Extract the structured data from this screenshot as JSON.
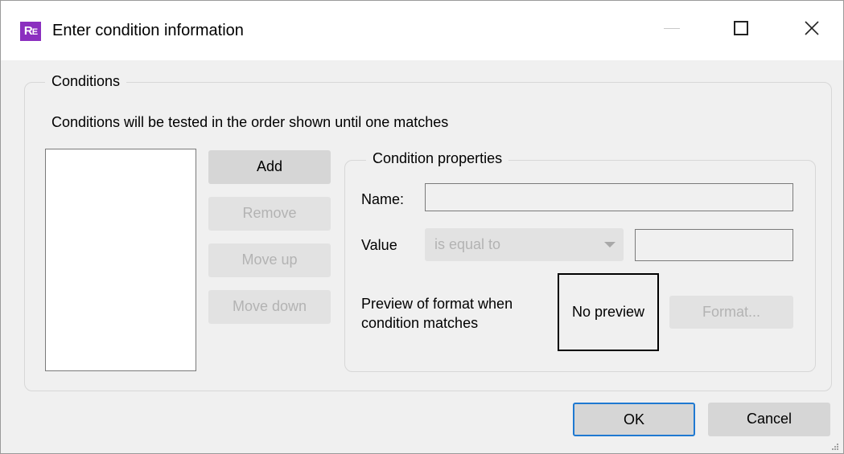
{
  "window": {
    "title": "Enter condition information",
    "icon_text": "RE",
    "icon_color": "#8b2fbf"
  },
  "conditions": {
    "legend": "Conditions",
    "description": "Conditions will be tested in the order shown until one matches",
    "list_items": [],
    "buttons": {
      "add": "Add",
      "remove": "Remove",
      "move_up": "Move up",
      "move_down": "Move down"
    }
  },
  "properties": {
    "legend": "Condition properties",
    "name_label": "Name:",
    "name_value": "",
    "value_label": "Value",
    "operator_selected": "is equal to",
    "value_value": "",
    "preview_label": "Preview of format when condition matches",
    "preview_text": "No preview",
    "format_button": "Format..."
  },
  "footer": {
    "ok": "OK",
    "cancel": "Cancel"
  },
  "colors": {
    "accent": "#1f79d1",
    "disabled_text": "#b3b3b3"
  }
}
